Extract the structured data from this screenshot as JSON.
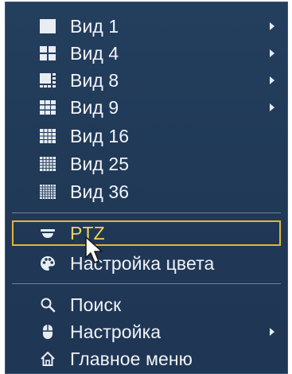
{
  "menu": {
    "items": [
      {
        "label": "Вид 1",
        "icon": "view-1-icon",
        "submenu": true
      },
      {
        "label": "Вид 4",
        "icon": "view-4-icon",
        "submenu": true
      },
      {
        "label": "Вид 8",
        "icon": "view-8-icon",
        "submenu": true
      },
      {
        "label": "Вид 9",
        "icon": "view-9-icon",
        "submenu": true
      },
      {
        "label": "Вид 16",
        "icon": "view-16-icon",
        "submenu": false
      },
      {
        "label": "Вид 25",
        "icon": "view-25-icon",
        "submenu": false
      },
      {
        "label": "Вид 36",
        "icon": "view-36-icon",
        "submenu": false
      },
      {
        "label": "PTZ",
        "icon": "ptz-camera-icon",
        "submenu": false,
        "selected": true
      },
      {
        "label": "Настройка цвета",
        "icon": "palette-icon",
        "submenu": false
      },
      {
        "label": "Поиск",
        "icon": "search-icon",
        "submenu": false
      },
      {
        "label": "Настройка",
        "icon": "mouse-settings-icon",
        "submenu": true
      },
      {
        "label": "Главное меню",
        "icon": "home-icon",
        "submenu": false
      }
    ]
  },
  "colors": {
    "background": "#213b5a",
    "text": "#f1f4f8",
    "highlight_border": "#e0b53a",
    "highlight_text": "#f3d25a"
  }
}
